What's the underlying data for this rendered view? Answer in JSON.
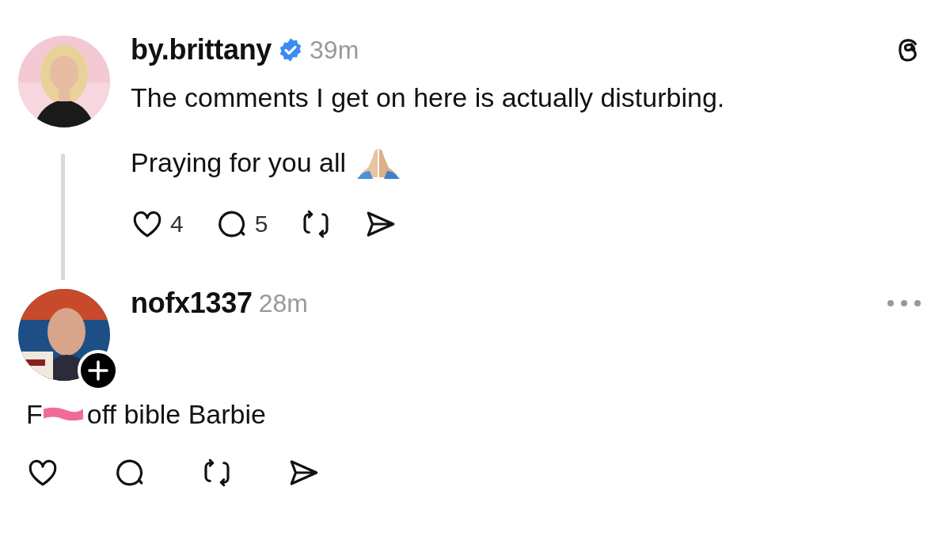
{
  "posts": [
    {
      "kind": "original",
      "username": "by.brittany",
      "verified": true,
      "time": "39m",
      "follow_badge": false,
      "thread_line": true,
      "paragraphs": [
        {
          "text": "The comments I get on here is actually disturbing.",
          "emoji": false
        },
        {
          "text": "Praying for you all",
          "emoji": true
        }
      ],
      "likes": "4",
      "replies": "5"
    },
    {
      "kind": "reply",
      "username": "nofx1337",
      "verified": false,
      "time": "28m",
      "follow_badge": true,
      "thread_line": false,
      "censored_text": {
        "before": "F",
        "after": "off bible Barbie"
      }
    }
  ]
}
